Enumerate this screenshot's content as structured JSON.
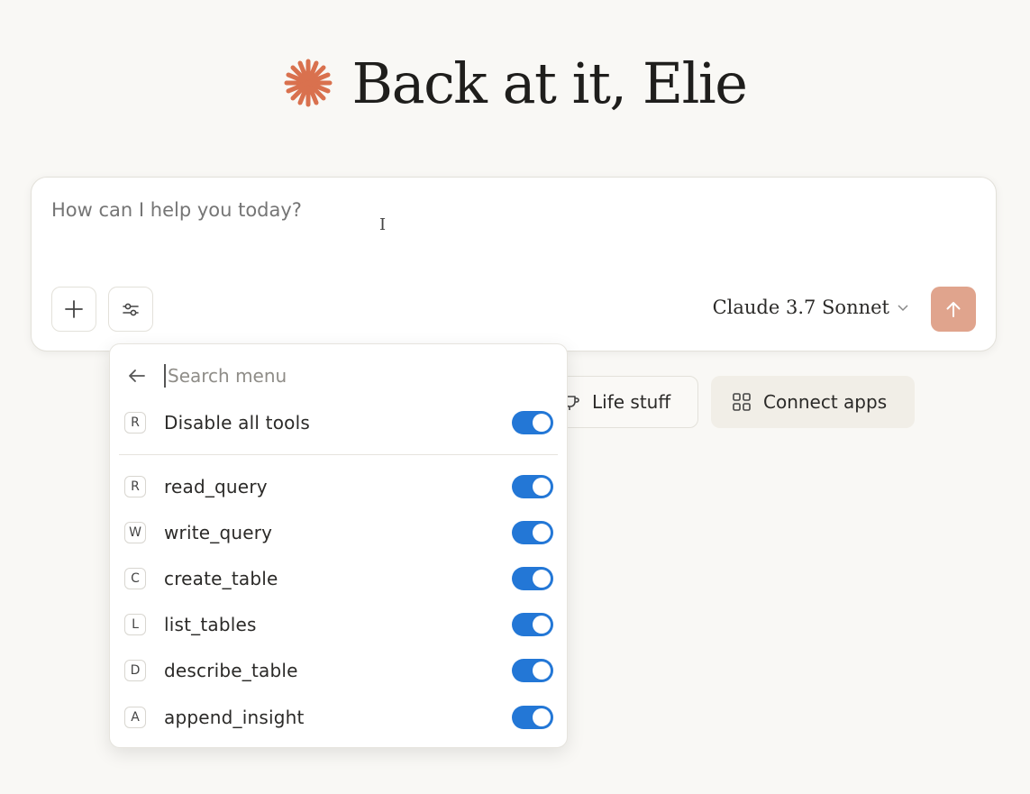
{
  "greeting": {
    "title": "Back at it, Elie",
    "logo_icon": "asterisk-burst-icon",
    "logo_color": "#d9714e"
  },
  "chat": {
    "placeholder": "How can I help you today?",
    "add_icon": "plus-icon",
    "tools_icon": "sliders-icon",
    "model_label": "Claude 3.7 Sonnet",
    "model_dropdown_icon": "chevron-down-icon",
    "send_icon": "arrow-up-icon",
    "send_color": "#e0a48d"
  },
  "chips": [
    {
      "label": "Life stuff",
      "icon": "cup-icon"
    },
    {
      "label": "Connect apps",
      "icon": "grid-icon"
    }
  ],
  "menu": {
    "search_placeholder": "Search menu",
    "back_icon": "arrow-left-icon",
    "disable_all": {
      "key": "R",
      "label": "Disable all tools",
      "enabled": true
    },
    "tools": [
      {
        "key": "R",
        "label": "read_query",
        "enabled": true
      },
      {
        "key": "W",
        "label": "write_query",
        "enabled": true
      },
      {
        "key": "C",
        "label": "create_table",
        "enabled": true
      },
      {
        "key": "L",
        "label": "list_tables",
        "enabled": true
      },
      {
        "key": "D",
        "label": "describe_table",
        "enabled": true
      },
      {
        "key": "A",
        "label": "append_insight",
        "enabled": true
      }
    ],
    "toggle_color": "#2377d6"
  }
}
